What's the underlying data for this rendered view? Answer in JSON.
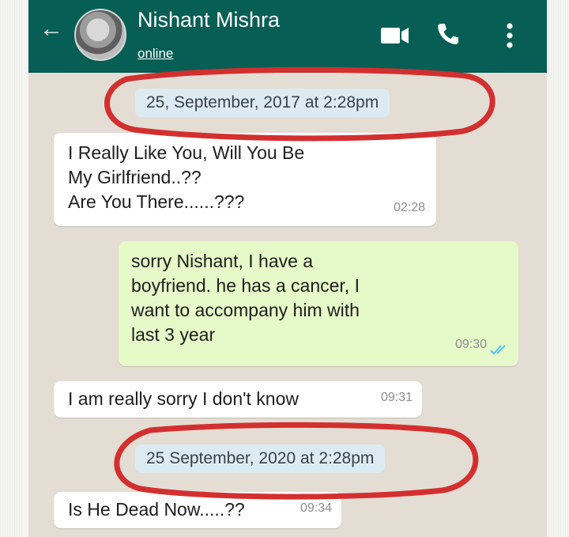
{
  "header": {
    "contact_name": "Nishant Mishra",
    "status": "online",
    "icons": [
      "back-arrow-icon",
      "avatar",
      "video-call-icon",
      "voice-call-icon",
      "more-options-icon"
    ]
  },
  "chat": {
    "date_separators": [
      "25, September, 2017 at 2:28pm",
      "25 September, 2020 at 2:28pm"
    ],
    "messages": [
      {
        "direction": "incoming",
        "lines": [
          "I Really Like You, Will You Be",
          "My Girlfriend..??",
          "Are You There......???"
        ],
        "time": "02:28"
      },
      {
        "direction": "outgoing",
        "lines": [
          "sorry Nishant, I have a",
          "boyfriend. he has a cancer, I",
          "want to accompany him with",
          "last 3 year"
        ],
        "time": "09:30",
        "read": true
      },
      {
        "direction": "incoming",
        "lines": [
          "I am really sorry I don't know"
        ],
        "time": "09:31"
      },
      {
        "direction": "incoming",
        "lines": [
          "Is He Dead Now.....??"
        ],
        "time": "09:34"
      }
    ]
  },
  "colors": {
    "header": "#075e54",
    "chat_background": "#e4ddd4",
    "outgoing_bubble": "#e6f9c8",
    "incoming_bubble": "#ffffff",
    "date_chip": "#dcebf2",
    "annotation_circle": "#d32f2f",
    "read_ticks": "#4fc3f7"
  }
}
